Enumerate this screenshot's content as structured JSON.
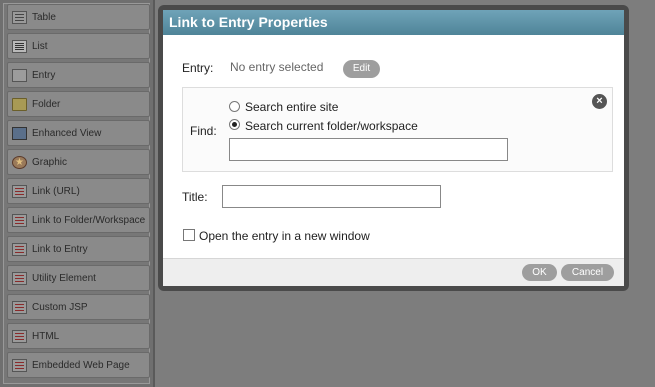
{
  "palette": {
    "items": [
      {
        "label": "Table",
        "icon": "table-icon"
      },
      {
        "label": "List",
        "icon": "list-icon"
      },
      {
        "label": "Entry",
        "icon": "entry-icon"
      },
      {
        "label": "Folder",
        "icon": "folder-icon"
      },
      {
        "label": "Enhanced View",
        "icon": "enhanced-view-icon"
      },
      {
        "label": "Graphic",
        "icon": "graphic-icon"
      },
      {
        "label": "Link (URL)",
        "icon": "link-url-icon"
      },
      {
        "label": "Link to Folder/Workspace",
        "icon": "link-folder-icon"
      },
      {
        "label": "Link to Entry",
        "icon": "link-entry-icon"
      },
      {
        "label": "Utility Element",
        "icon": "utility-element-icon"
      },
      {
        "label": "Custom JSP",
        "icon": "custom-jsp-icon"
      },
      {
        "label": "HTML",
        "icon": "html-icon"
      },
      {
        "label": "Embedded Web Page",
        "icon": "embedded-web-page-icon"
      }
    ]
  },
  "dialog": {
    "title": "Link to Entry Properties",
    "entry_label": "Entry:",
    "entry_value": "No entry selected",
    "edit_button": "Edit",
    "find_label": "Find:",
    "option_entire_site": "Search entire site",
    "option_current_folder": "Search current folder/workspace",
    "find_value": "",
    "title_label": "Title:",
    "title_value": "",
    "open_new_window_label": "Open the entry in a new window",
    "ok_button": "OK",
    "cancel_button": "Cancel"
  },
  "colors": {
    "header_accent": "#5f93a8",
    "backdrop": "#7d7d7d"
  }
}
